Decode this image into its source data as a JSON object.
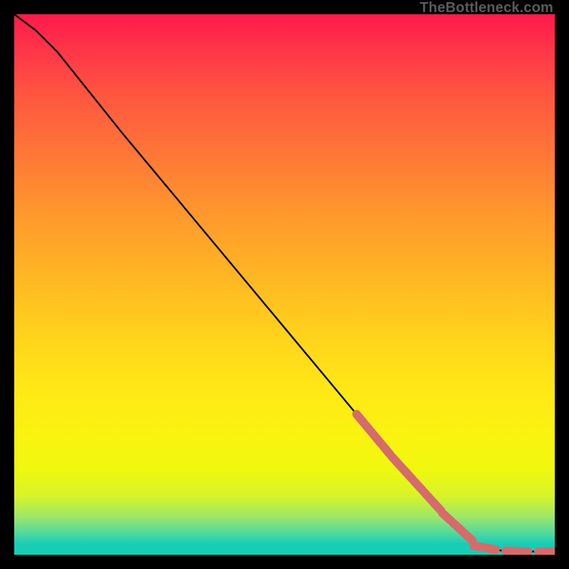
{
  "attribution": "TheBottleneck.com",
  "chart_data": {
    "type": "line",
    "title": "",
    "xlabel": "",
    "ylabel": "",
    "xlim": [
      0,
      100
    ],
    "ylim": [
      0,
      100
    ],
    "curve": [
      {
        "x": 0,
        "y": 100
      },
      {
        "x": 4,
        "y": 97
      },
      {
        "x": 8,
        "y": 93
      },
      {
        "x": 12,
        "y": 88
      },
      {
        "x": 20,
        "y": 78
      },
      {
        "x": 30,
        "y": 66
      },
      {
        "x": 40,
        "y": 54
      },
      {
        "x": 50,
        "y": 42
      },
      {
        "x": 60,
        "y": 30
      },
      {
        "x": 70,
        "y": 18
      },
      {
        "x": 80,
        "y": 7
      },
      {
        "x": 86,
        "y": 1.5
      },
      {
        "x": 90,
        "y": 0.8
      },
      {
        "x": 95,
        "y": 0.6
      },
      {
        "x": 100,
        "y": 0.6
      }
    ],
    "marker_clusters": [
      {
        "x_start": 64,
        "x_end": 72,
        "count": 6
      },
      {
        "x_start": 73,
        "x_end": 80,
        "count": 5
      },
      {
        "x_start": 82,
        "x_end": 88,
        "count": 4
      },
      {
        "x_start": 92,
        "x_end": 94,
        "count": 2
      },
      {
        "x_start": 98,
        "x_end": 100,
        "count": 2
      }
    ],
    "colors": {
      "curve": "#000000",
      "marker_fill": "#d66b6b",
      "marker_stroke": "#d66b6b"
    }
  }
}
